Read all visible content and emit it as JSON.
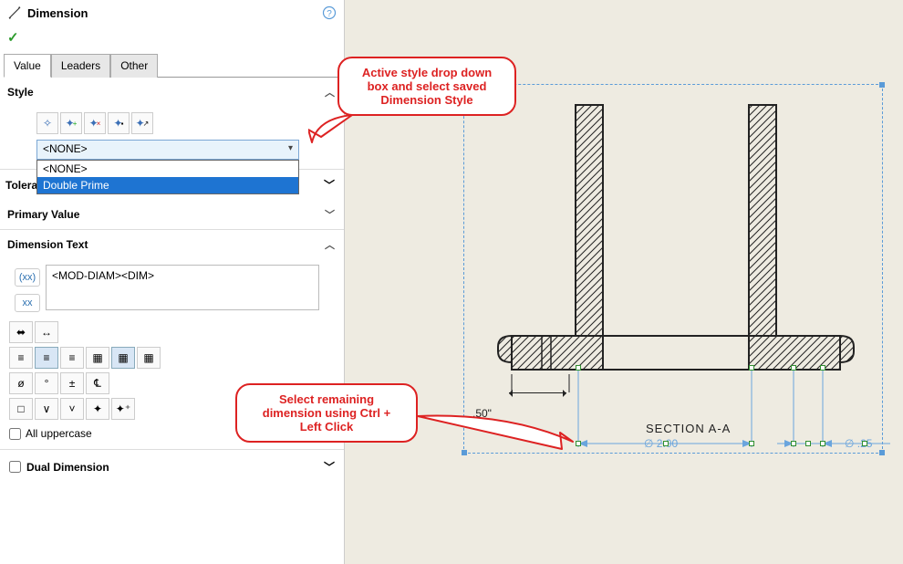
{
  "panel": {
    "title": "Dimension",
    "accept_icon": "✓",
    "tabs": {
      "value": "Value",
      "leaders": "Leaders",
      "other": "Other"
    },
    "style": {
      "header": "Style",
      "dropdown_selected": "<NONE>",
      "options": {
        "none": "<NONE>",
        "double_prime": "Double Prime"
      }
    },
    "tolerance_header": "Tolera",
    "primary_value_header": "Primary Value",
    "dim_text": {
      "header": "Dimension Text",
      "value": "<MOD-DIAM><DIM>",
      "xx1": "(xx)",
      "xx2": "xx"
    },
    "icons": {
      "r1a": "⬌",
      "r1b": "↔",
      "align1": "≡",
      "align2": "≡",
      "align3": "≡",
      "grid1": "▦",
      "grid2": "▦",
      "grid3": "▦",
      "diam": "ø",
      "deg": "°",
      "pm": "±",
      "cl": "℄",
      "sq": "□",
      "dn": "∨",
      "up": "˅",
      "star": "✦",
      "plus": "✦⁺"
    },
    "all_upper_label": "All uppercase",
    "dual_dim_label": "Dual Dimension"
  },
  "viewport": {
    "section_label": "SECTION A-A",
    "dim_50": ".50\"",
    "dim_200": "2.00",
    "dim_25": ".25",
    "phi": "∅"
  },
  "callouts": {
    "top": {
      "l1": "Active style drop down",
      "l2": "box and select saved",
      "l3": "Dimension Style"
    },
    "bottom": {
      "l1": "Select remaining",
      "l2": "dimension using Ctrl +",
      "l3": "Left Click"
    }
  }
}
